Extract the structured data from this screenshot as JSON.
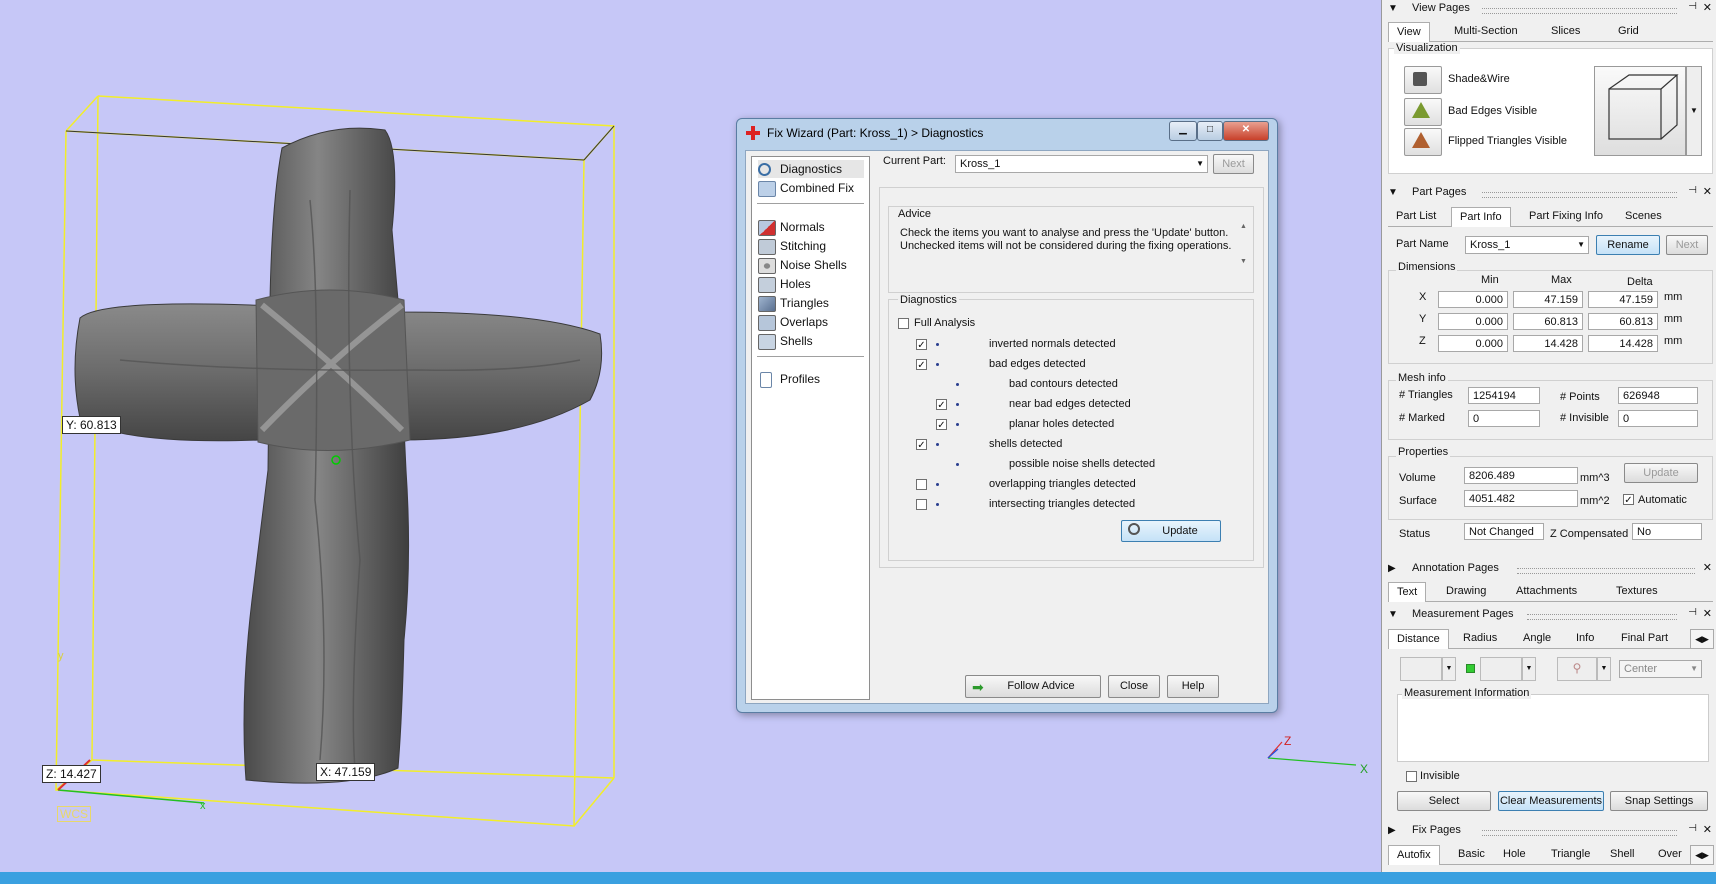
{
  "viewport": {
    "y_label": "Y: 60.813",
    "z_label": "Z: 14.427",
    "x_label": "X: 47.159",
    "wcs_label": "WCS",
    "axis_y": "y",
    "axis_x": "x",
    "gizmo_z": "Z",
    "gizmo_x": "X"
  },
  "dialog": {
    "title": "Fix Wizard (Part: Kross_1) > Diagnostics",
    "nav_top": [
      {
        "label": "Diagnostics",
        "icon": "magnifier-icon"
      },
      {
        "label": "Combined Fix",
        "icon": "cube-icon"
      }
    ],
    "nav_mid": [
      {
        "label": "Normals",
        "icon": "normals-icon"
      },
      {
        "label": "Stitching",
        "icon": "stitching-icon"
      },
      {
        "label": "Noise Shells",
        "icon": "noise-shells-icon"
      },
      {
        "label": "Holes",
        "icon": "holes-icon"
      },
      {
        "label": "Triangles",
        "icon": "triangles-icon"
      },
      {
        "label": "Overlaps",
        "icon": "overlaps-icon"
      },
      {
        "label": "Shells",
        "icon": "shells-icon"
      }
    ],
    "nav_bottom": [
      {
        "label": "Profiles",
        "icon": "profiles-icon"
      }
    ],
    "current_part_label": "Current Part:",
    "current_part_value": "Kross_1",
    "next_label": "Next",
    "advice_label": "Advice",
    "advice_text": "Check the items you want to analyse and press the 'Update' button. Unchecked items will not be considered during the fixing operations.",
    "diagnostics_label": "Diagnostics",
    "full_analysis_label": "Full Analysis",
    "items": [
      {
        "label": "inverted normals detected",
        "checked": true,
        "level": 0,
        "has_checkbox": true
      },
      {
        "label": "bad edges detected",
        "checked": true,
        "level": 0,
        "has_checkbox": true
      },
      {
        "label": "bad contours detected",
        "checked": false,
        "level": 1,
        "has_checkbox": false
      },
      {
        "label": "near bad edges detected",
        "checked": true,
        "level": 1,
        "has_checkbox": true
      },
      {
        "label": "planar holes detected",
        "checked": true,
        "level": 1,
        "has_checkbox": true
      },
      {
        "label": "shells detected",
        "checked": true,
        "level": 0,
        "has_checkbox": true
      },
      {
        "label": "possible noise shells detected",
        "checked": false,
        "level": 1,
        "has_checkbox": false
      },
      {
        "label": "overlapping triangles detected",
        "checked": false,
        "level": 0,
        "has_checkbox": true
      },
      {
        "label": "intersecting triangles detected",
        "checked": false,
        "level": 0,
        "has_checkbox": true
      }
    ],
    "update_label": "Update",
    "follow_advice_label": "Follow Advice",
    "close_label": "Close",
    "help_label": "Help"
  },
  "view_pages": {
    "title": "View Pages",
    "tabs": [
      "View",
      "Multi-Section",
      "Slices",
      "Grid"
    ],
    "visualization_label": "Visualization",
    "options": [
      "Shade&Wire",
      "Bad Edges Visible",
      "Flipped Triangles Visible"
    ]
  },
  "part_pages": {
    "title": "Part Pages",
    "tabs": [
      "Part List",
      "Part Info",
      "Part Fixing Info",
      "Scenes"
    ],
    "part_name_label": "Part Name",
    "part_name_value": "Kross_1",
    "rename_label": "Rename",
    "next_label": "Next",
    "dimensions_label": "Dimensions",
    "col_min": "Min",
    "col_max": "Max",
    "col_delta": "Delta",
    "rows": [
      {
        "axis": "X",
        "min": "0.000",
        "max": "47.159",
        "delta": "47.159",
        "unit": "mm"
      },
      {
        "axis": "Y",
        "min": "0.000",
        "max": "60.813",
        "delta": "60.813",
        "unit": "mm"
      },
      {
        "axis": "Z",
        "min": "0.000",
        "max": "14.428",
        "delta": "14.428",
        "unit": "mm"
      }
    ],
    "mesh_info_label": "Mesh info",
    "triangles_label": "# Triangles",
    "triangles_value": "1254194",
    "points_label": "# Points",
    "points_value": "626948",
    "marked_label": "# Marked",
    "marked_value": "0",
    "invisible_label": "# Invisible",
    "invisible_value": "0",
    "properties_label": "Properties",
    "volume_label": "Volume",
    "volume_value": "8206.489",
    "volume_unit": "mm^3",
    "update_label": "Update",
    "surface_label": "Surface",
    "surface_value": "4051.482",
    "surface_unit": "mm^2",
    "automatic_label": "Automatic",
    "status_label": "Status",
    "status_value": "Not Changed",
    "zcomp_label": "Z Compensated",
    "zcomp_value": "No"
  },
  "annotation_pages": {
    "title": "Annotation Pages",
    "tabs": [
      "Text",
      "Drawing",
      "Attachments",
      "Textures"
    ]
  },
  "measurement_pages": {
    "title": "Measurement Pages",
    "tabs": [
      "Distance",
      "Radius",
      "Angle",
      "Info",
      "Final Part"
    ],
    "center_value": "Center",
    "info_label": "Measurement Information",
    "invisible_label": "Invisible",
    "select_label": "Select",
    "clear_label": "Clear Measurements",
    "snap_label": "Snap Settings"
  },
  "fix_pages": {
    "title": "Fix Pages",
    "tabs": [
      "Autofix",
      "Basic",
      "Hole",
      "Triangle",
      "Shell",
      "Over"
    ]
  },
  "colors": {
    "viewport_bg": "#c6c7f7",
    "bounding_box": "#f2ee2a",
    "mesh": "#6d6d6d",
    "taskbar": "#3aa0e0"
  }
}
